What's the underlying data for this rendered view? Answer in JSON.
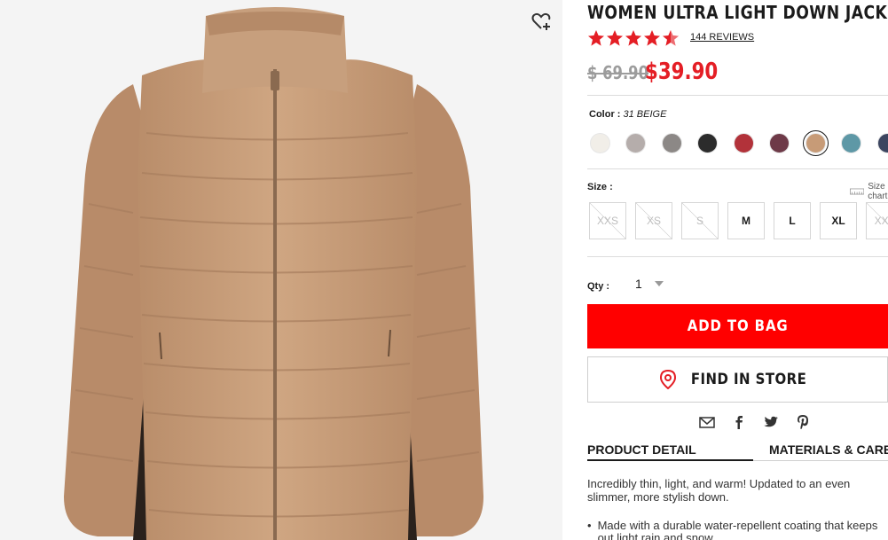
{
  "product": {
    "title": "WOMEN ULTRA LIGHT DOWN JACKET",
    "reviews": "144 REVIEWS",
    "rating": 4.5,
    "price_original": "$ 69.90",
    "price_sale": "$39.90"
  },
  "color": {
    "label": "Color :",
    "selected": "31 BEIGE",
    "swatches": [
      "#f1eee8",
      "#b5adab",
      "#8c8886",
      "#2c2c2c",
      "#b2323a",
      "#6e3a48",
      "#c79b77",
      "#5e98a6",
      "#3c4560"
    ]
  },
  "size": {
    "label": "Size :",
    "chart_label": "Size chart",
    "options": [
      {
        "label": "XXS",
        "available": false
      },
      {
        "label": "XS",
        "available": false
      },
      {
        "label": "S",
        "available": false
      },
      {
        "label": "M",
        "available": true
      },
      {
        "label": "L",
        "available": true
      },
      {
        "label": "XL",
        "available": true
      },
      {
        "label": "XXL",
        "available": false
      }
    ]
  },
  "qty": {
    "label": "Qty :",
    "value": "1"
  },
  "buttons": {
    "add_to_bag": "ADD TO BAG",
    "find_in_store": "FIND IN STORE"
  },
  "tabs": [
    "PRODUCT DETAIL",
    "MATERIALS & CARE"
  ],
  "detail": {
    "description": "Incredibly thin, light, and warm! Updated to an even slimmer, more stylish down.",
    "bullet": "Made with a durable water-repellent coating that keeps out light rain and snow."
  },
  "colors": {
    "accent": "#ff0000",
    "sale": "#e41e25",
    "jacket": "#c49a78"
  }
}
